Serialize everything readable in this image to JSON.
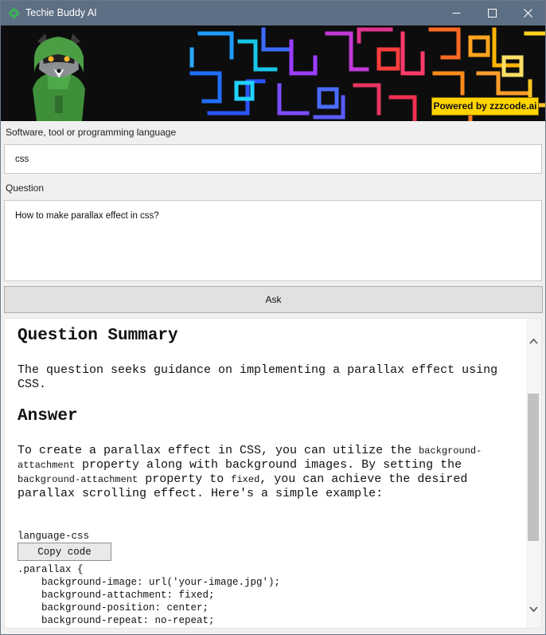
{
  "window": {
    "title": "Techie Buddy AI",
    "icons": [
      "app-gear-icon",
      "minimize-icon",
      "maximize-icon",
      "close-icon"
    ]
  },
  "banner": {
    "powered_by": "Powered by zzzcode.ai",
    "badge_color": "#ffd400"
  },
  "form": {
    "language_label": "Software, tool or programming language",
    "language_value": "css",
    "question_label": "Question",
    "question_value": "How to make parallax effect in css?",
    "ask_label": "Ask"
  },
  "output": {
    "summary_heading": "Question Summary",
    "summary_text": "The question seeks guidance on implementing a parallax effect using CSS.",
    "answer_heading": "Answer",
    "answer_parts": [
      "To create a parallax effect in CSS, you can utilize the ",
      "background-attachment",
      " property along with background images. By setting the ",
      "background-attachment",
      " property to ",
      "fixed",
      ", you can achieve the desired parallax scrolling effect. Here's a simple example:"
    ],
    "code_language": "language-css",
    "copy_label": "Copy code",
    "code_lines": [
      ".parallax {",
      "    background-image: url('your-image.jpg');",
      "    background-attachment: fixed;",
      "    background-position: center;",
      "    background-repeat: no-repeat;"
    ]
  },
  "colors": {
    "titlebar": "#5d6f84",
    "banner_bg": "#0d0d0d",
    "ask_button": "#e1e1e1"
  }
}
